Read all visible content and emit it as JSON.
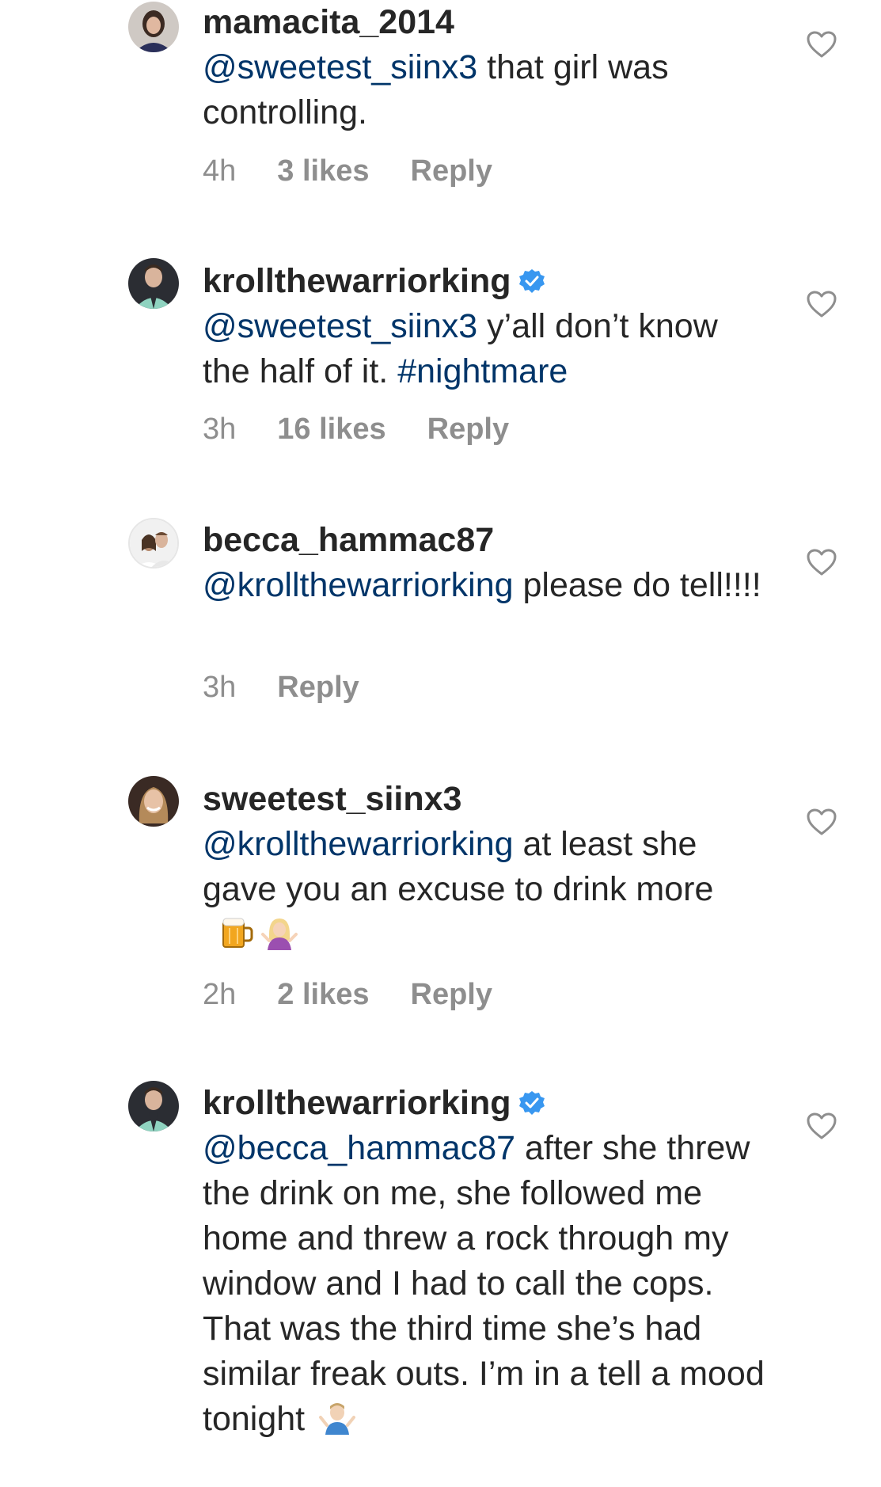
{
  "comments": [
    {
      "username": "mamacita_2014",
      "verified": false,
      "mention": "@sweetest_siinx3",
      "text_1": " that girl was controlling.",
      "time": "4h",
      "likes": "3 likes",
      "reply": "Reply"
    },
    {
      "username": "krollthewarriorking",
      "verified": true,
      "mention": "@sweetest_siinx3",
      "text_1": " y’all don’t know the half of it. ",
      "hashtag": "#nightmare",
      "time": "3h",
      "likes": "16 likes",
      "reply": "Reply"
    },
    {
      "username": "becca_hammac87",
      "verified": false,
      "mention": "@krollthewarriorking",
      "text_1": " please do tell!!!!",
      "time": "3h",
      "reply": "Reply"
    },
    {
      "username": "sweetest_siinx3",
      "verified": false,
      "mention": "@krollthewarriorking",
      "text_1": " at least she gave you an excuse to drink more",
      "emojis": [
        "beer-mug-emoji",
        "shrugging-woman-emoji"
      ],
      "time": "2h",
      "likes": "2 likes",
      "reply": "Reply"
    },
    {
      "username": "krollthewarriorking",
      "verified": true,
      "mention": "@becca_hammac87",
      "text_1": " after she threw the drink on me, she followed me home and threw a rock through my window and I had to call the cops. That was the third time she’s had similar freak outs. I’m in a tell a mood tonight",
      "emojis": [
        "shrugging-man-emoji"
      ]
    }
  ],
  "colors": {
    "text": "#262626",
    "mention": "#003569",
    "meta": "#8e8e8e",
    "verified_badge": "#3897f0"
  },
  "icons": {
    "like": "heart-outline-icon",
    "verified": "verified-badge-icon"
  }
}
